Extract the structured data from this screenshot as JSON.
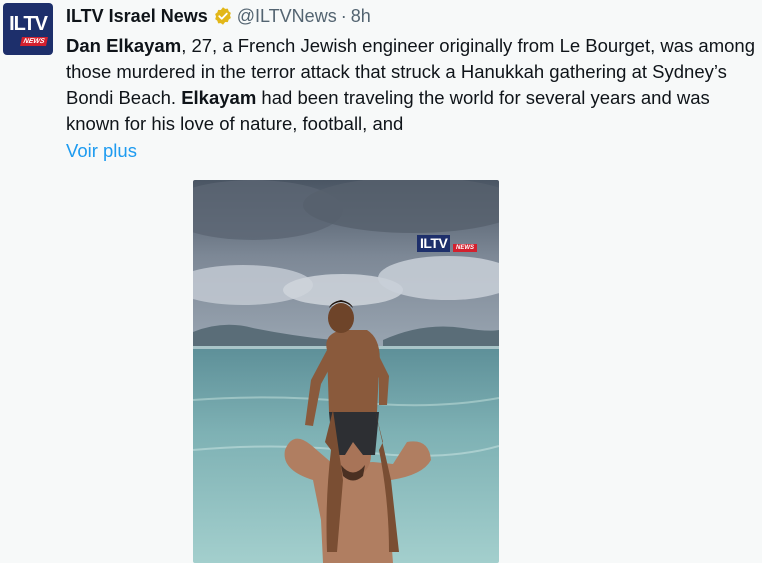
{
  "tweet": {
    "author_name": "ILTV Israel News",
    "handle": "@ILTVNews",
    "separator": "·",
    "time": "8h",
    "avatar": {
      "text": "ILTV",
      "subtext": "NEWS"
    },
    "text_parts": {
      "p1_bold": "Dan Elkayam",
      "p1": ", 27, a French Jewish engineer originally from Le Bourget, was among those murdered in the terror attack that struck a Hanukkah gathering at Sydney’s Bondi Beach. ",
      "p2_bold": "Elkayam",
      "p2": " had been traveling the world for several years and was known for his love of nature, football, and"
    },
    "see_more": "Voir plus",
    "media": {
      "watermark_main": "ILTV",
      "watermark_sub": "NEWS",
      "scene": "man in sea carrying child on shoulders under cloudy sky"
    }
  },
  "colors": {
    "background": "#f7f9f9",
    "link": "#1d9bf0",
    "secondary_text": "#536471",
    "verified_badge": "#e2b719",
    "brand_navy": "#1d2f6b",
    "brand_red": "#d3202e"
  },
  "icons": {
    "verified": "verified-badge-icon"
  }
}
